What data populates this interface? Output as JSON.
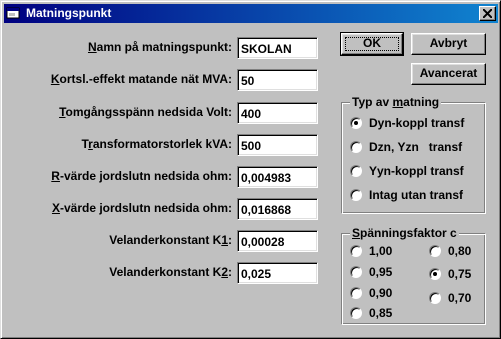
{
  "window": {
    "title": "Matningspunkt",
    "icon": "window-app-icon",
    "close_icon": "close-icon"
  },
  "fields": [
    {
      "label": "Namn på matningspunkt:",
      "value": "SKOLAN"
    },
    {
      "label": "Kortsl.-effekt matande nät MVA:",
      "value": "50"
    },
    {
      "label": "Tomgångsspänn nedsida Volt:",
      "value": "400"
    },
    {
      "label": "Transformatorstorlek kVA:",
      "value": "500"
    },
    {
      "label": "R-värde jordslutn nedsida ohm:",
      "value": "0,004983"
    },
    {
      "label": "X-värde jordslutn nedsida ohm:",
      "value": "0,016868"
    },
    {
      "label": "Velanderkonstant K1:",
      "value": "0,00028"
    },
    {
      "label": "Velanderkonstant K2:",
      "value": "0,025"
    }
  ],
  "buttons": {
    "ok": "OK",
    "cancel": "Avbryt",
    "advanced": "Avancerat"
  },
  "typ_group": {
    "title": "Typ av matning",
    "options": [
      "Dyn-koppl transf",
      "Dzn, Yzn   transf",
      "Yyn-koppl transf",
      "Intag utan transf"
    ],
    "selected": "Dyn-koppl transf"
  },
  "factor_group": {
    "title": "Spänningsfaktor c",
    "options": [
      "1,00",
      "0,95",
      "0,90",
      "0,85",
      "0,80",
      "0,75",
      "0,70"
    ],
    "selected": "0,75"
  }
}
